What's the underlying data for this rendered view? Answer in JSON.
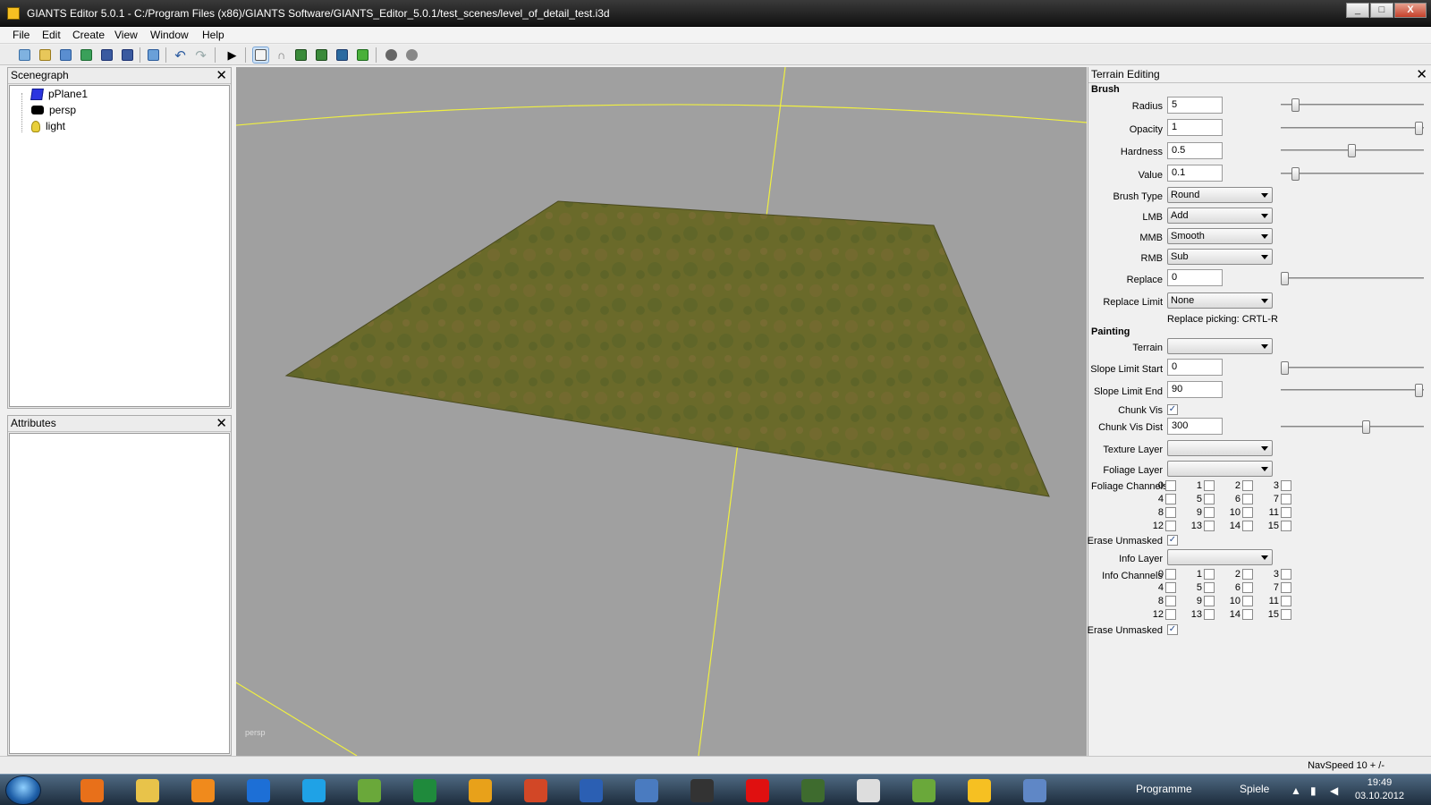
{
  "window": {
    "title": "GIANTS Editor 5.0.1 - C:/Program Files (x86)/GIANTS Software/GIANTS_Editor_5.0.1/test_scenes/level_of_detail_test.i3d",
    "minimize": "_",
    "maximize": "□",
    "close": "X"
  },
  "menu": {
    "file": "File",
    "edit": "Edit",
    "create": "Create",
    "view": "View",
    "window": "Window",
    "help": "Help"
  },
  "toolbar": {
    "icons": [
      "new-scene-icon",
      "open-icon",
      "open-list-icon",
      "refresh-icon",
      "save-icon",
      "save-as-icon",
      "import-icon",
      "undo-icon",
      "redo-icon",
      "play-icon",
      "select-tool-icon",
      "move-tool-icon",
      "terrain-sculpt-icon",
      "terrain-paint-icon",
      "terrain-smooth-icon",
      "foliage-paint-icon",
      "render-settings-icon",
      "render-options-icon"
    ]
  },
  "scenegraph": {
    "title": "Scenegraph",
    "close": "✕",
    "items": [
      {
        "label": "pPlane1",
        "icon": "cube-icon",
        "color": "#2b35e0"
      },
      {
        "label": "persp",
        "icon": "camera-icon",
        "color": "#000000"
      },
      {
        "label": "light",
        "icon": "lightbulb-icon",
        "color": "#e8cf3a"
      }
    ]
  },
  "attributes": {
    "title": "Attributes",
    "close": "✕"
  },
  "viewport": {
    "label": "persp",
    "background": "#a0a0a0",
    "grid_color": "#f0f040"
  },
  "terrain": {
    "title": "Terrain Editing",
    "close": "✕",
    "brush": {
      "section": "Brush",
      "radius": {
        "label": "Radius",
        "value": "5",
        "slider": 0.08
      },
      "opacity": {
        "label": "Opacity",
        "value": "1",
        "slider": 1.0
      },
      "hardness": {
        "label": "Hardness",
        "value": "0.5",
        "slider": 0.5
      },
      "value": {
        "label": "Value",
        "value": "0.1",
        "slider": 0.1
      },
      "brush_type": {
        "label": "Brush Type",
        "selected": "Round"
      },
      "lmb": {
        "label": "LMB",
        "selected": "Add"
      },
      "mmb": {
        "label": "MMB",
        "selected": "Smooth"
      },
      "rmb": {
        "label": "RMB",
        "selected": "Sub"
      },
      "replace": {
        "label": "Replace",
        "value": "0",
        "slider": 0.0
      },
      "replace_limit": {
        "label": "Replace Limit",
        "selected": "None"
      },
      "replace_picking": "Replace picking: CRTL-R"
    },
    "painting": {
      "section": "Painting",
      "terrain": {
        "label": "Terrain",
        "selected": ""
      },
      "slope_start": {
        "label": "Slope Limit Start",
        "value": "0",
        "slider": 0.0
      },
      "slope_end": {
        "label": "Slope Limit End",
        "value": "90",
        "slider": 1.0
      },
      "chunk_vis": {
        "label": "Chunk Vis",
        "checked": true
      },
      "chunk_vis_dist": {
        "label": "Chunk Vis Dist",
        "value": "300",
        "slider": 0.6
      },
      "texture_layer": {
        "label": "Texture Layer",
        "selected": ""
      },
      "foliage_layer": {
        "label": "Foliage Layer",
        "selected": ""
      },
      "foliage_channels_label": "Foliage Channels",
      "erase_unmasked_1": {
        "label": "Erase Unmasked",
        "checked": true
      },
      "info_layer": {
        "label": "Info Layer",
        "selected": ""
      },
      "info_channels_label": "Info Channels",
      "erase_unmasked_2": {
        "label": "Erase Unmasked",
        "checked": true
      },
      "channels": [
        "0",
        "1",
        "2",
        "3",
        "4",
        "5",
        "6",
        "7",
        "8",
        "9",
        "10",
        "11",
        "12",
        "13",
        "14",
        "15"
      ]
    }
  },
  "status": {
    "navspeed": "NavSpeed 10 + /-"
  },
  "taskbar": {
    "apps": [
      {
        "icon": "firefox-icon",
        "color": "#e8701a"
      },
      {
        "icon": "explorer-icon",
        "color": "#e8c34a"
      },
      {
        "icon": "media-player-icon",
        "color": "#f08a1c"
      },
      {
        "icon": "teamviewer-icon",
        "color": "#1d6fd6"
      },
      {
        "icon": "skype-icon",
        "color": "#1fa2e6"
      },
      {
        "icon": "quantum-gis-icon",
        "color": "#6aa83a"
      },
      {
        "icon": "excel-icon",
        "color": "#1f8a3c"
      },
      {
        "icon": "outlook-icon",
        "color": "#e8a11a"
      },
      {
        "icon": "powerpoint-icon",
        "color": "#d24726"
      },
      {
        "icon": "word-icon",
        "color": "#2b5fb3"
      },
      {
        "icon": "thunderbird-icon",
        "color": "#4a7bc0"
      },
      {
        "icon": "monitor-icon",
        "color": "#333333"
      },
      {
        "icon": "record-icon",
        "color": "#e01010"
      },
      {
        "icon": "tractor-icon",
        "color": "#3e6b2e"
      },
      {
        "icon": "editor-icon",
        "color": "#dddddd"
      },
      {
        "icon": "quantum-gis-2-icon",
        "color": "#6aa83a"
      },
      {
        "icon": "giants-editor-icon",
        "color": "#f6c022"
      },
      {
        "icon": "remote-desktop-icon",
        "color": "#5f87c6"
      }
    ],
    "programme": "Programme",
    "spiele": "Spiele",
    "time": "19:49",
    "date": "03.10.2012"
  }
}
